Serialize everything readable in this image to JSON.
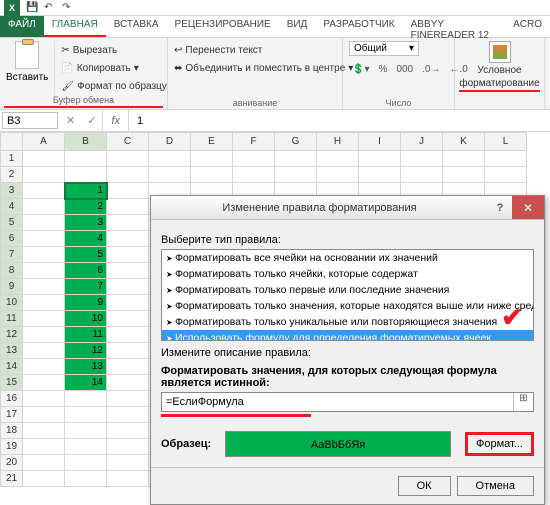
{
  "qat": {
    "save": "💾",
    "undo": "↶",
    "redo": "↷"
  },
  "tabs": {
    "file": "ФАЙЛ",
    "home": "ГЛАВНАЯ",
    "insert": "ВСТАВКА",
    "review": "РЕЦЕНЗИРОВАНИЕ",
    "view": "ВИД",
    "developer": "РАЗРАБОТЧИК",
    "abbyy": "ABBYY FineReader 12",
    "acro": "ACRO"
  },
  "clipboard": {
    "paste": "Вставить",
    "cut": "Вырезать",
    "copy": "Копировать",
    "painter": "Формат по образцу",
    "group": "Буфер обмена"
  },
  "alignment": {
    "wrap": "Перенести текст",
    "merge": "Объединить и поместить в центре",
    "group": "авнивание"
  },
  "number": {
    "combo": "Общий",
    "group": "Число"
  },
  "condfmt": {
    "label": "Условное",
    "label2": "форматирование"
  },
  "namebox": "B3",
  "formula_value": "1",
  "columns": [
    "A",
    "B",
    "C",
    "D",
    "E",
    "F",
    "G",
    "H",
    "I",
    "J",
    "K",
    "L"
  ],
  "rows": [
    1,
    2,
    3,
    4,
    5,
    6,
    7,
    8,
    9,
    10,
    11,
    12,
    13,
    14,
    15,
    16,
    17,
    18,
    19,
    20,
    21
  ],
  "cells": {
    "B3": "1",
    "B4": "2",
    "B5": "3",
    "B6": "4",
    "B7": "5",
    "B8": "6",
    "B9": "7",
    "B10": "9",
    "B11": "10",
    "B12": "11",
    "B13": "12",
    "B14": "13",
    "B15": "14"
  },
  "green_cells": [
    "B3",
    "B4",
    "B5",
    "B6",
    "B7",
    "B8",
    "B9",
    "B10",
    "B11",
    "B12",
    "B13",
    "B14",
    "B15"
  ],
  "dialog": {
    "title": "Изменение правила форматирования",
    "select_type": "Выберите тип правила:",
    "rules": [
      "Форматировать все ячейки на основании их значений",
      "Форматировать только ячейки, которые содержат",
      "Форматировать только первые или последние значения",
      "Форматировать только значения, которые находятся выше или ниже среднего",
      "Форматировать только уникальные или повторяющиеся значения",
      "Использовать формулу для определения форматируемых ячеек"
    ],
    "edit_desc": "Измените описание правила:",
    "formula_label": "Форматировать значения, для которых следующая формула является истинной:",
    "formula_value": "=ЕслиФормула",
    "preview_label": "Образец:",
    "preview_text": "АаВbБбЯя",
    "format_btn": "Формат...",
    "ok": "ОК",
    "cancel": "Отмена"
  }
}
